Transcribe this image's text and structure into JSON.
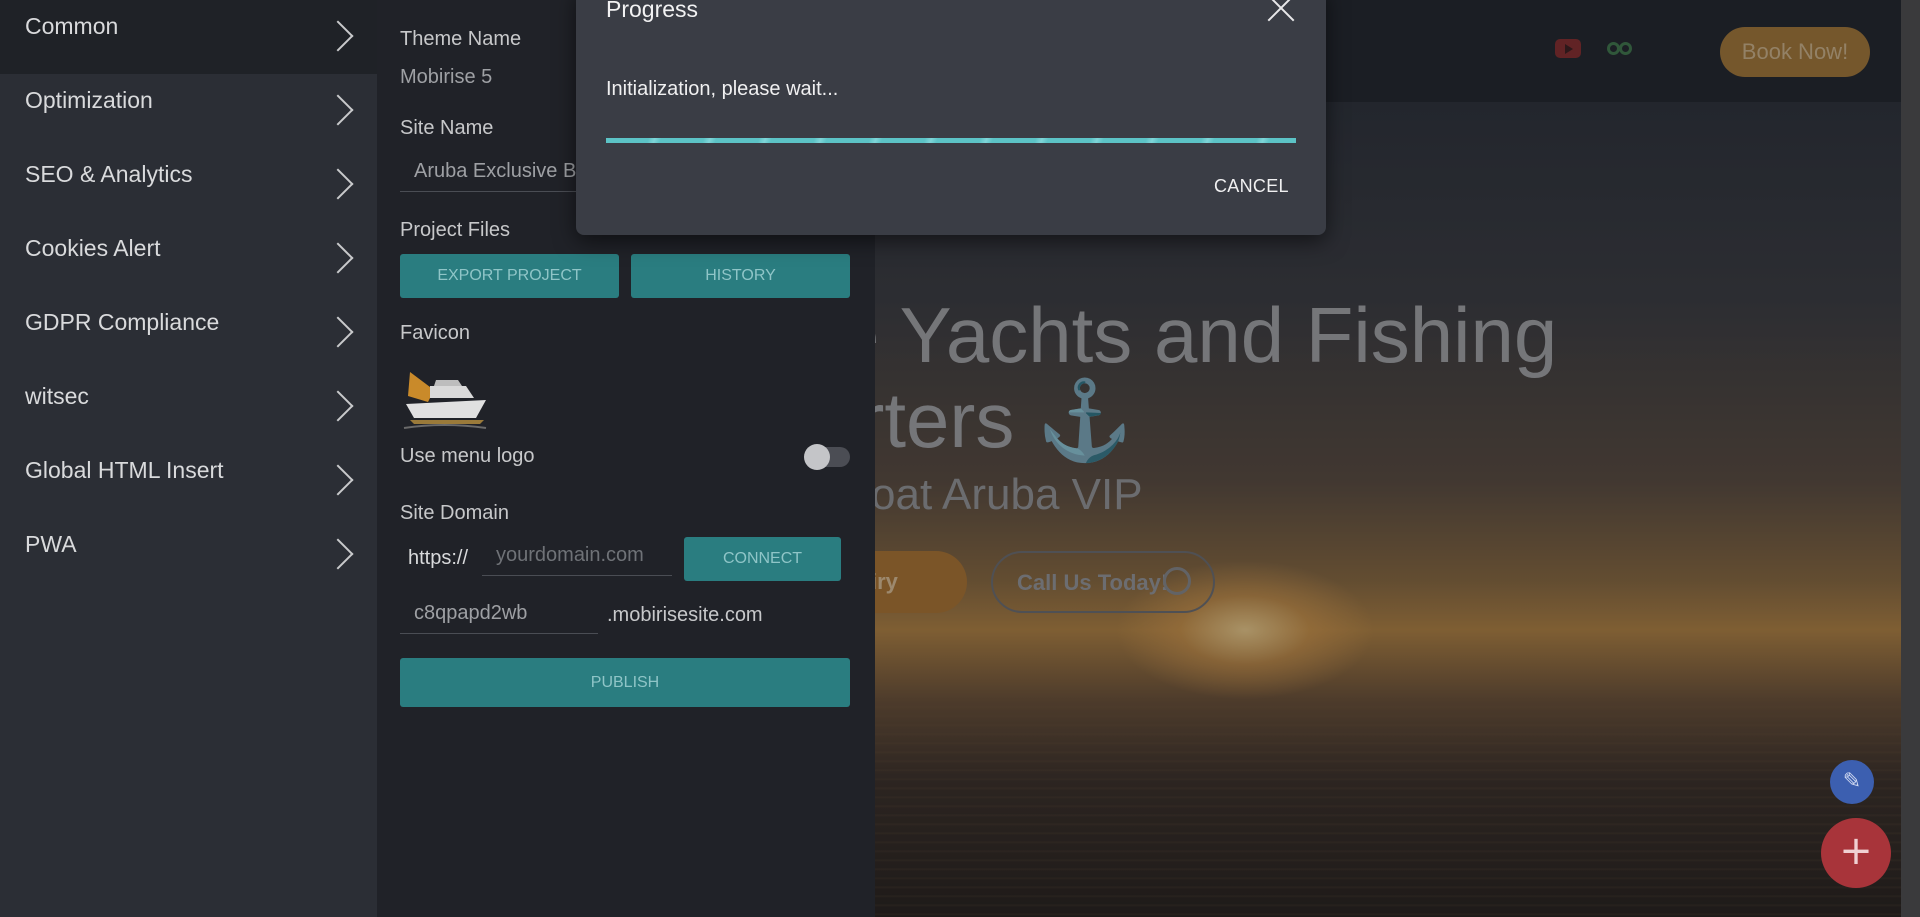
{
  "left_nav": {
    "items": [
      {
        "label": "Common"
      },
      {
        "label": "Optimization"
      },
      {
        "label": "SEO & Analytics"
      },
      {
        "label": "Cookies Alert"
      },
      {
        "label": "GDPR Compliance"
      },
      {
        "label": "witsec"
      },
      {
        "label": "Global HTML Insert"
      },
      {
        "label": "PWA"
      }
    ]
  },
  "settings": {
    "theme_name_label": "Theme Name",
    "theme_name_value": "Mobirise 5",
    "site_name_label": "Site Name",
    "site_name_value": "Aruba Exclusive Boat",
    "project_files_label": "Project Files",
    "export_button": "EXPORT PROJECT",
    "history_button": "HISTORY",
    "favicon_label": "Favicon",
    "use_menu_logo_label": "Use menu logo",
    "use_menu_logo_on": false,
    "site_domain_label": "Site Domain",
    "domain_prefix": "https://",
    "domain_placeholder": "yourdomain.com",
    "connect_button": "CONNECT",
    "subdomain_value": "c8qpapd2wb",
    "subdomain_suffix": ".mobirisesite.com",
    "publish_button": "PUBLISH"
  },
  "modal": {
    "title": "Progress",
    "message": "Initialization, please wait...",
    "progress": 1.0,
    "cancel_button": "CANCEL"
  },
  "preview": {
    "book_button": "Book Now!",
    "hero_line1": "ve Yachts and Fishing",
    "hero_line2": "arters ⚓",
    "hero_subtitle": "e Boat Aruba VIP",
    "inquiry_button": "iry",
    "call_button": "Call Us Today!"
  },
  "colors": {
    "accent": "#2a7d80",
    "progress": "#5cc3c6",
    "book_button": "#a97a35",
    "fab_add": "#a8343a",
    "fab_edit": "#3c5fb0"
  }
}
